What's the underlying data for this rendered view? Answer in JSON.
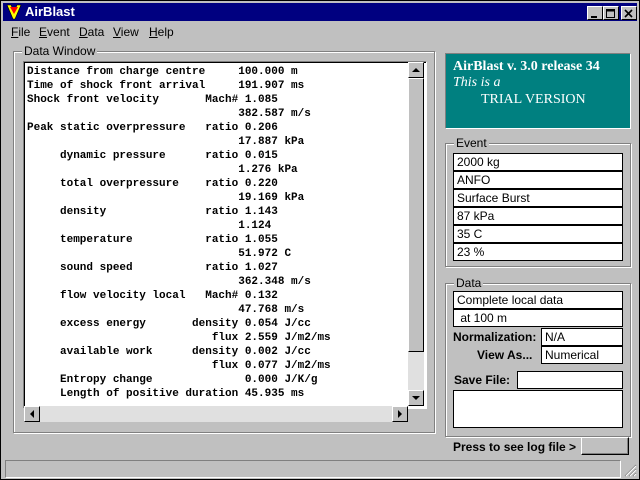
{
  "window": {
    "title": "AirBlast"
  },
  "menu": [
    {
      "key": "F",
      "rest": "ile"
    },
    {
      "key": "E",
      "rest": "vent"
    },
    {
      "key": "D",
      "rest": "ata"
    },
    {
      "key": "V",
      "rest": "iew"
    },
    {
      "key": "H",
      "rest": "elp"
    }
  ],
  "data_window": {
    "title": "Data Window",
    "lines": [
      "Distance from charge centre     100.000 m",
      "Time of shock front arrival     191.907 ms",
      "Shock front velocity       Mach# 1.085",
      "                                382.587 m/s",
      "Peak static overpressure   ratio 0.206",
      "                                17.887 kPa",
      "     dynamic pressure      ratio 0.015",
      "                                1.276 kPa",
      "     total overpressure    ratio 0.220",
      "                                19.169 kPa",
      "     density               ratio 1.143",
      "                                1.124",
      "     temperature           ratio 1.055",
      "                                51.972 C",
      "     sound speed           ratio 1.027",
      "                                362.348 m/s",
      "     flow velocity local   Mach# 0.132",
      "                                47.768 m/s",
      "     excess energy       density 0.054 J/cc",
      "                            flux 2.559 J/m2/ms",
      "     available work      density 0.002 J/cc",
      "                            flux 0.077 J/m2/ms",
      "     Entropy change              0.000 J/K/g",
      "     Length of positive duration 45.935 ms"
    ]
  },
  "banner": {
    "line1": "AirBlast v. 3.0 release 34",
    "line2": "This is a",
    "line3": "TRIAL VERSION"
  },
  "event": {
    "title": "Event",
    "fields": [
      "2000  kg",
      "ANFO",
      "Surface Burst",
      "87 kPa",
      "35 C",
      "23 %"
    ]
  },
  "data_panel": {
    "title": "Data",
    "summary1": "Complete local data",
    "summary2": " at 100 m",
    "normalization_label": "Normalization:",
    "normalization_value": "N/A",
    "view_label": "View As...",
    "view_value": "Numerical",
    "save_label": "Save File:",
    "save_value": ""
  },
  "log": {
    "label": "Press to see log file >"
  },
  "colors": {
    "titlebar": "#000080",
    "banner": "#008080",
    "face": "#c0c0c0"
  }
}
